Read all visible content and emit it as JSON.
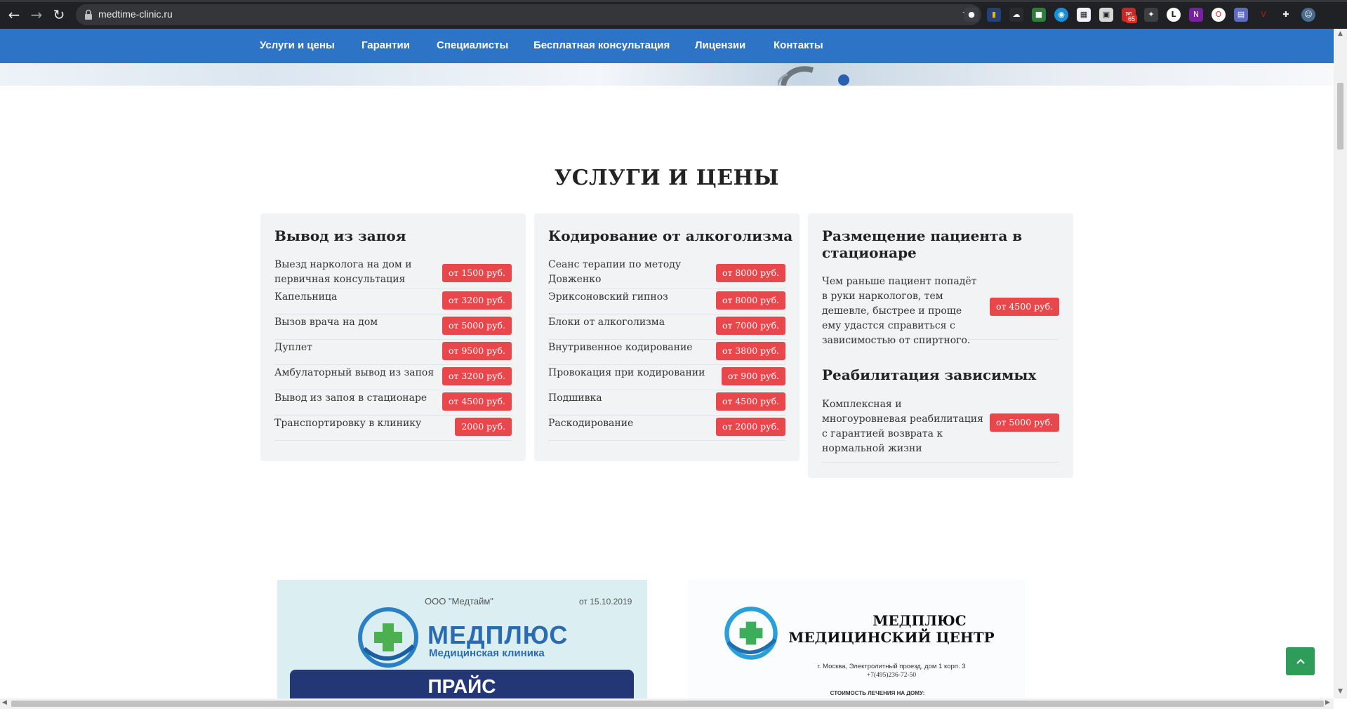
{
  "browser": {
    "url": "medtime-clinic.ru",
    "extension_badge": "65"
  },
  "nav": {
    "items": [
      "Услуги и цены",
      "Гарантии",
      "Специалисты",
      "Бесплатная консультация",
      "Лицензии",
      "Контакты"
    ]
  },
  "section": {
    "title": "УСЛУГИ И ЦЕНЫ"
  },
  "cards": [
    {
      "title": "Вывод из запоя",
      "rows": [
        {
          "label": "Выезд нарколога на дом и первичная консультация",
          "price": "от 1500 руб."
        },
        {
          "label": "Капельница",
          "price": "от 3200 руб."
        },
        {
          "label": "Вызов врача на дом",
          "price": "от 5000 руб."
        },
        {
          "label": "Дуплет",
          "price": "от 9500 руб."
        },
        {
          "label": "Амбулаторный вывод из запоя",
          "price": "от 3200 руб."
        },
        {
          "label": "Вывод из запоя в стационаре",
          "price": "от 4500 руб."
        },
        {
          "label": "Транспортировку в клинику",
          "price": "2000 руб."
        }
      ]
    },
    {
      "title": "Кодирование от алкоголизма",
      "rows": [
        {
          "label": "Сеанс терапии по методу Довженко",
          "price": "от 8000 руб."
        },
        {
          "label": "Эриксоновский гипноз",
          "price": "от 8000 руб."
        },
        {
          "label": "Блоки от алкоголизма",
          "price": "от 7000 руб."
        },
        {
          "label": "Внутривенное кодирование",
          "price": "от 3800 руб."
        },
        {
          "label": "Провокация при кодировании",
          "price": "от 900 руб."
        },
        {
          "label": "Подшивка",
          "price": "от 4500 руб."
        },
        {
          "label": "Раскодирование",
          "price": "от 2000 руб."
        }
      ]
    },
    {
      "title": "Размещение пациента в стационаре",
      "rows": [
        {
          "label": "Чем раньше пациент попадёт в руки наркологов, тем дешевле, быстрее и проще ему удастся справиться с зависимостью от спиртного.",
          "price": "от 4500 руб."
        }
      ],
      "title2": "Реабилитация зависимых",
      "rows2": [
        {
          "label": "Комплексная и многоуровневая реабилитация с гарантией возврата к нормальной жизни",
          "price": "от 5000 руб."
        }
      ]
    }
  ],
  "licenses": {
    "lic1": {
      "company": "ООО \"Медтайм\"",
      "date": "от 15.10.2019",
      "brand": "МЕДПЛЮС",
      "subtitle": "Медицинская клиника",
      "banner": "ПРАЙС"
    },
    "lic2": {
      "brand_line1": "МЕДПЛЮС",
      "brand_line2": "МЕДИЦИНСКИЙ ЦЕНТР",
      "address": "г. Москва, Электролитный проезд, дом 1 корп. 3",
      "phone": "+7(495)236-72-50",
      "cost_note": "СТОИМОСТЬ ЛЕЧЕНИЯ НА ДОМУ:"
    }
  },
  "colors": {
    "nav_bg": "#2d74c7",
    "price_bg": "#e8474c",
    "card_bg": "#f2f3f5",
    "scroll_top_bg": "#2f9d5a"
  }
}
